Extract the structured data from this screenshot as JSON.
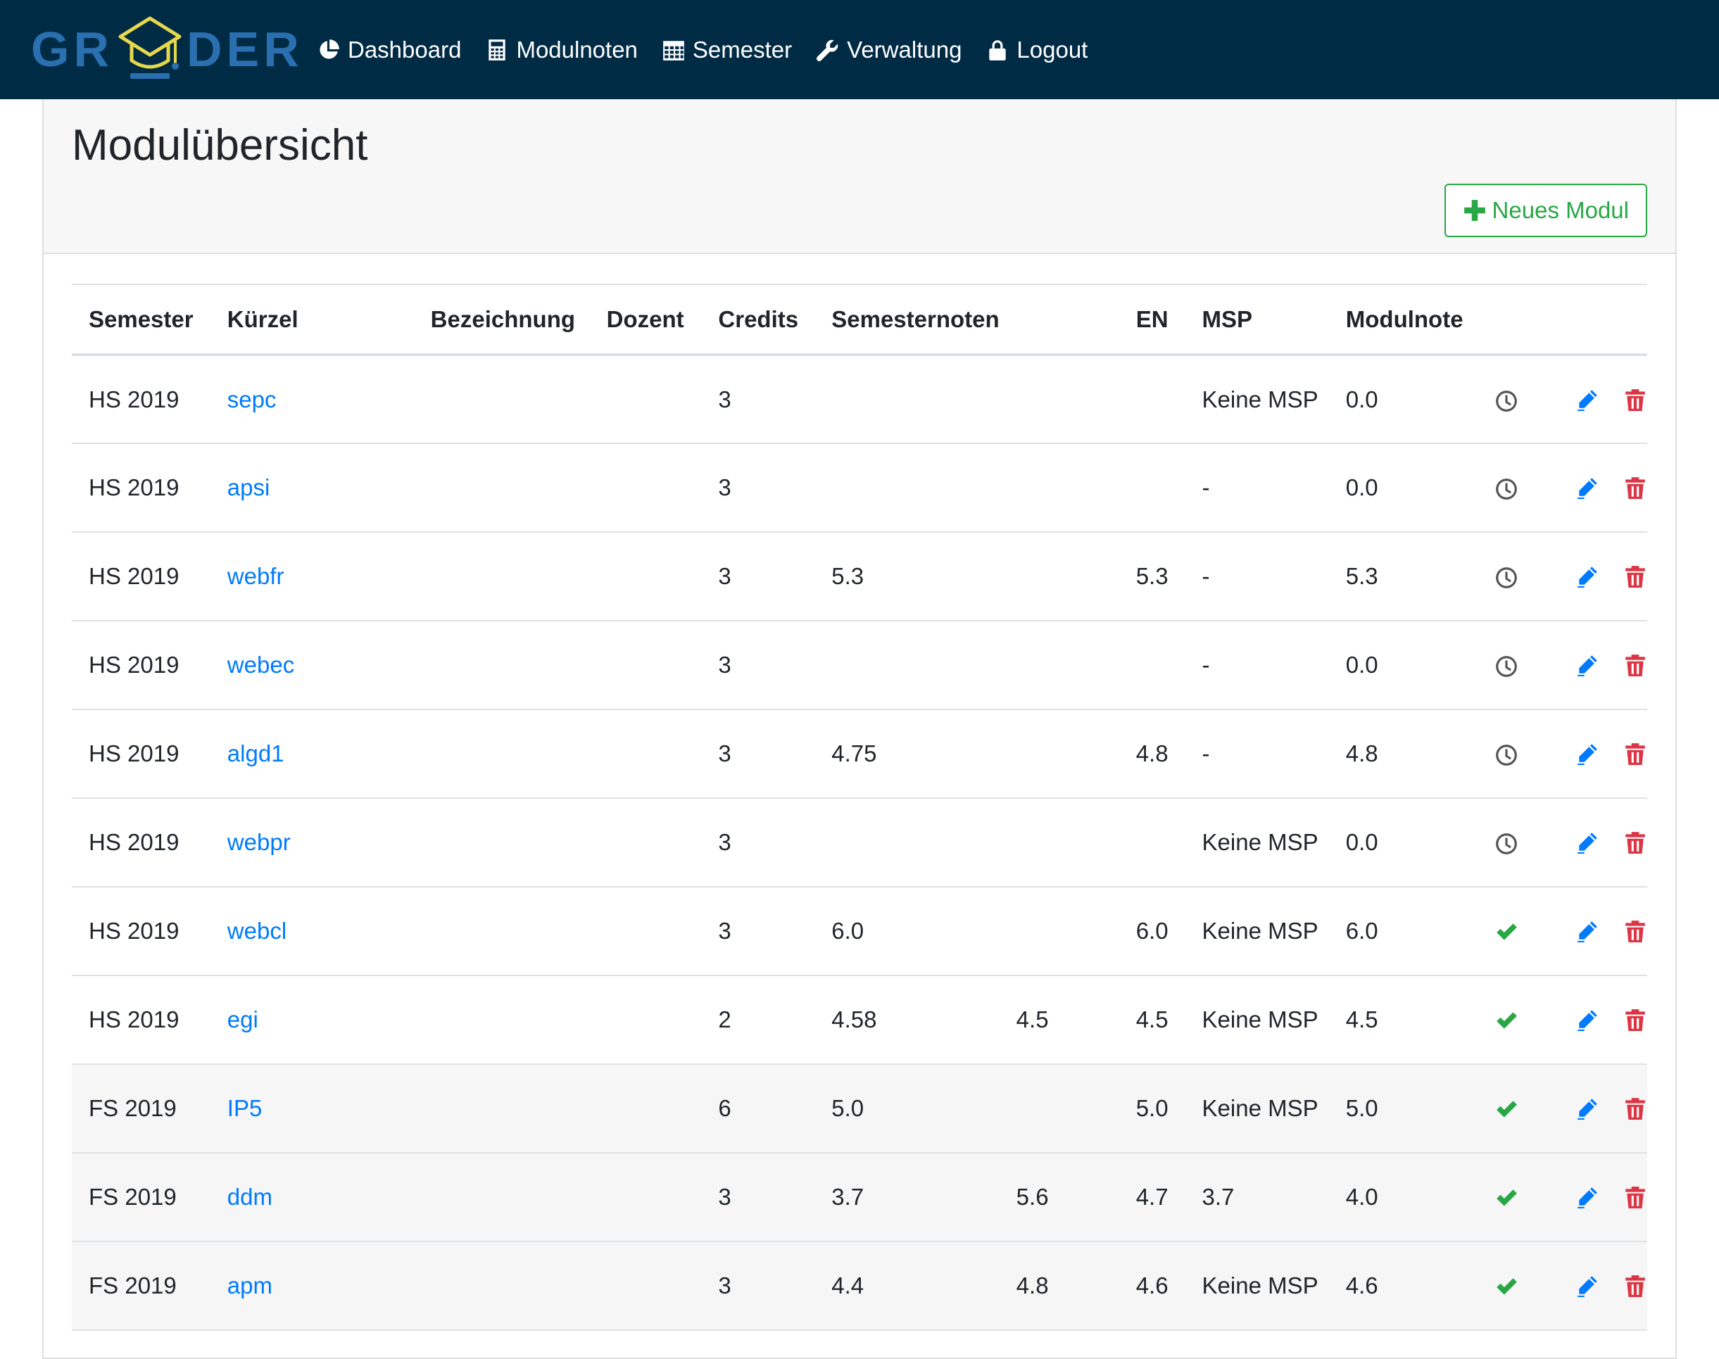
{
  "brand": {
    "logo_text_left": "GR",
    "logo_text_right": "DER"
  },
  "nav": [
    {
      "label": "Dashboard",
      "icon": "pie-chart-icon"
    },
    {
      "label": "Modulnoten",
      "icon": "calculator-icon"
    },
    {
      "label": "Semester",
      "icon": "calendar-icon"
    },
    {
      "label": "Verwaltung",
      "icon": "wrench-icon"
    },
    {
      "label": "Logout",
      "icon": "lock-icon"
    }
  ],
  "page": {
    "title": "Modulübersicht",
    "new_button_label": "Neues Modul"
  },
  "table": {
    "headers": [
      "Semester",
      "Kürzel",
      "Bezeichnung",
      "Dozent",
      "Credits",
      "Semesternoten",
      "EN",
      "MSP",
      "Modulnote"
    ],
    "rows": [
      {
        "semester": "HS 2019",
        "kuerzel": "sepc",
        "bezeichnung": "",
        "dozent": "",
        "credits": "3",
        "sn1": "",
        "sn2": "",
        "en": "",
        "msp": "Keine MSP",
        "modulnote": "0.0",
        "status": "clock"
      },
      {
        "semester": "HS 2019",
        "kuerzel": "apsi",
        "bezeichnung": "",
        "dozent": "",
        "credits": "3",
        "sn1": "",
        "sn2": "",
        "en": "",
        "msp": "-",
        "modulnote": "0.0",
        "status": "clock"
      },
      {
        "semester": "HS 2019",
        "kuerzel": "webfr",
        "bezeichnung": "",
        "dozent": "",
        "credits": "3",
        "sn1": "5.3",
        "sn2": "",
        "en": "5.3",
        "msp": "-",
        "modulnote": "5.3",
        "status": "clock"
      },
      {
        "semester": "HS 2019",
        "kuerzel": "webec",
        "bezeichnung": "",
        "dozent": "",
        "credits": "3",
        "sn1": "",
        "sn2": "",
        "en": "",
        "msp": "-",
        "modulnote": "0.0",
        "status": "clock"
      },
      {
        "semester": "HS 2019",
        "kuerzel": "algd1",
        "bezeichnung": "",
        "dozent": "",
        "credits": "3",
        "sn1": "4.75",
        "sn2": "",
        "en": "4.8",
        "msp": "-",
        "modulnote": "4.8",
        "status": "clock"
      },
      {
        "semester": "HS 2019",
        "kuerzel": "webpr",
        "bezeichnung": "",
        "dozent": "",
        "credits": "3",
        "sn1": "",
        "sn2": "",
        "en": "",
        "msp": "Keine MSP",
        "modulnote": "0.0",
        "status": "clock"
      },
      {
        "semester": "HS 2019",
        "kuerzel": "webcl",
        "bezeichnung": "",
        "dozent": "",
        "credits": "3",
        "sn1": "6.0",
        "sn2": "",
        "en": "6.0",
        "msp": "Keine MSP",
        "modulnote": "6.0",
        "status": "check"
      },
      {
        "semester": "HS 2019",
        "kuerzel": "egi",
        "bezeichnung": "",
        "dozent": "",
        "credits": "2",
        "sn1": "4.58",
        "sn2": "4.5",
        "en": "4.5",
        "msp": "Keine MSP",
        "modulnote": "4.5",
        "status": "check"
      },
      {
        "semester": "FS 2019",
        "kuerzel": "IP5",
        "bezeichnung": "",
        "dozent": "",
        "credits": "6",
        "sn1": "5.0",
        "sn2": "",
        "en": "5.0",
        "msp": "Keine MSP",
        "modulnote": "5.0",
        "status": "check"
      },
      {
        "semester": "FS 2019",
        "kuerzel": "ddm",
        "bezeichnung": "",
        "dozent": "",
        "credits": "3",
        "sn1": "3.7",
        "sn2": "5.6",
        "en": "4.7",
        "msp": "3.7",
        "modulnote": "4.0",
        "status": "check"
      },
      {
        "semester": "FS 2019",
        "kuerzel": "apm",
        "bezeichnung": "",
        "dozent": "",
        "credits": "3",
        "sn1": "4.4",
        "sn2": "4.8",
        "en": "4.6",
        "msp": "Keine MSP",
        "modulnote": "4.6",
        "status": "check"
      }
    ]
  },
  "colors": {
    "navbar": "#002b45",
    "link": "#007bff",
    "success": "#28a745",
    "danger": "#dc3545",
    "logo": "#2a6fb0",
    "logo_cap": "#e6d84a"
  }
}
